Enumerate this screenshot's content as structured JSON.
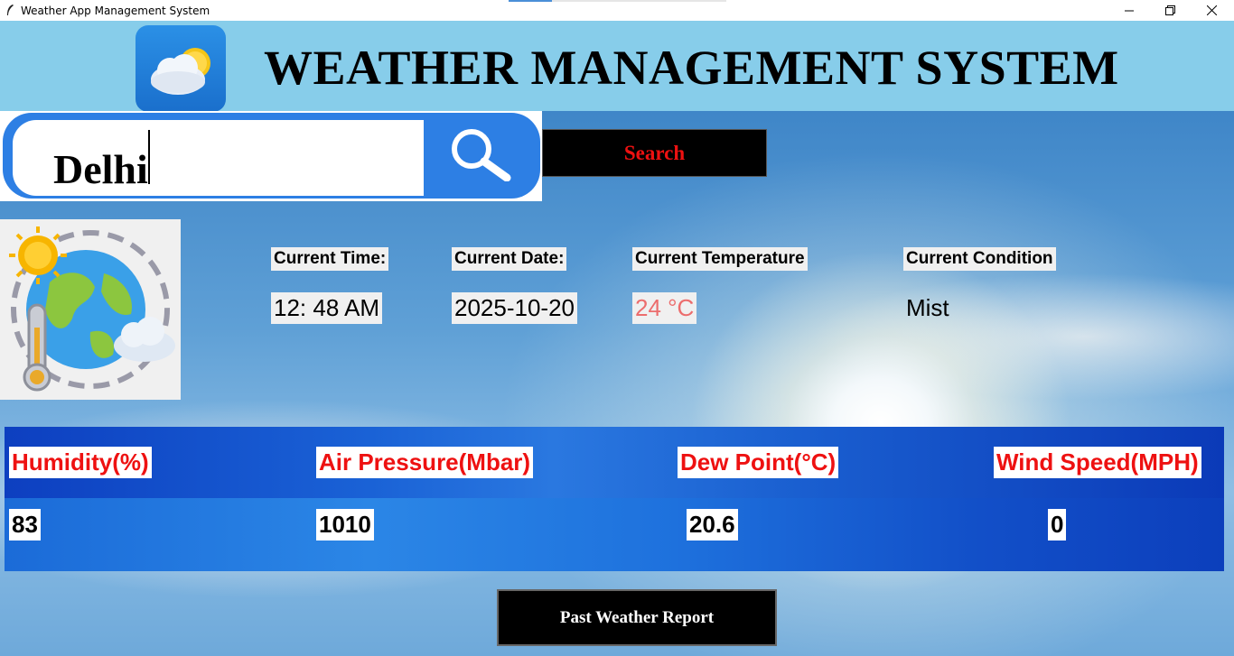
{
  "window": {
    "title": "Weather App Management System",
    "controls": [
      "minimize-icon",
      "restore-icon",
      "close-icon"
    ]
  },
  "header": {
    "title": "WEATHER MANAGEMENT SYSTEM",
    "logo_icon": "weather-logo-icon",
    "background": "#87cdea"
  },
  "search": {
    "value": "Delhi",
    "icon": "search-icon",
    "button_label": "Search",
    "button_color": "#e11111"
  },
  "current": {
    "time_label": "Current Time:",
    "time_value": "12: 48 AM",
    "date_label": "Current Date:",
    "date_value": "2025-10-20",
    "temperature_label": "Current Temperature",
    "temperature_value": "24 °C",
    "condition_label": "Current Condition",
    "condition_value": "Mist",
    "illustration_icon": "globe-thermometer-icon"
  },
  "metrics": {
    "humidity_label": "Humidity(%)",
    "humidity_value": "83",
    "pressure_label": "Air Pressure(Mbar)",
    "pressure_value": "1010",
    "dew_point_label": "Dew Point(°C)",
    "dew_point_value": "20.6",
    "wind_label": "Wind Speed(MPH)",
    "wind_value": "0"
  },
  "actions": {
    "past_report_label": "Past Weather Report"
  }
}
